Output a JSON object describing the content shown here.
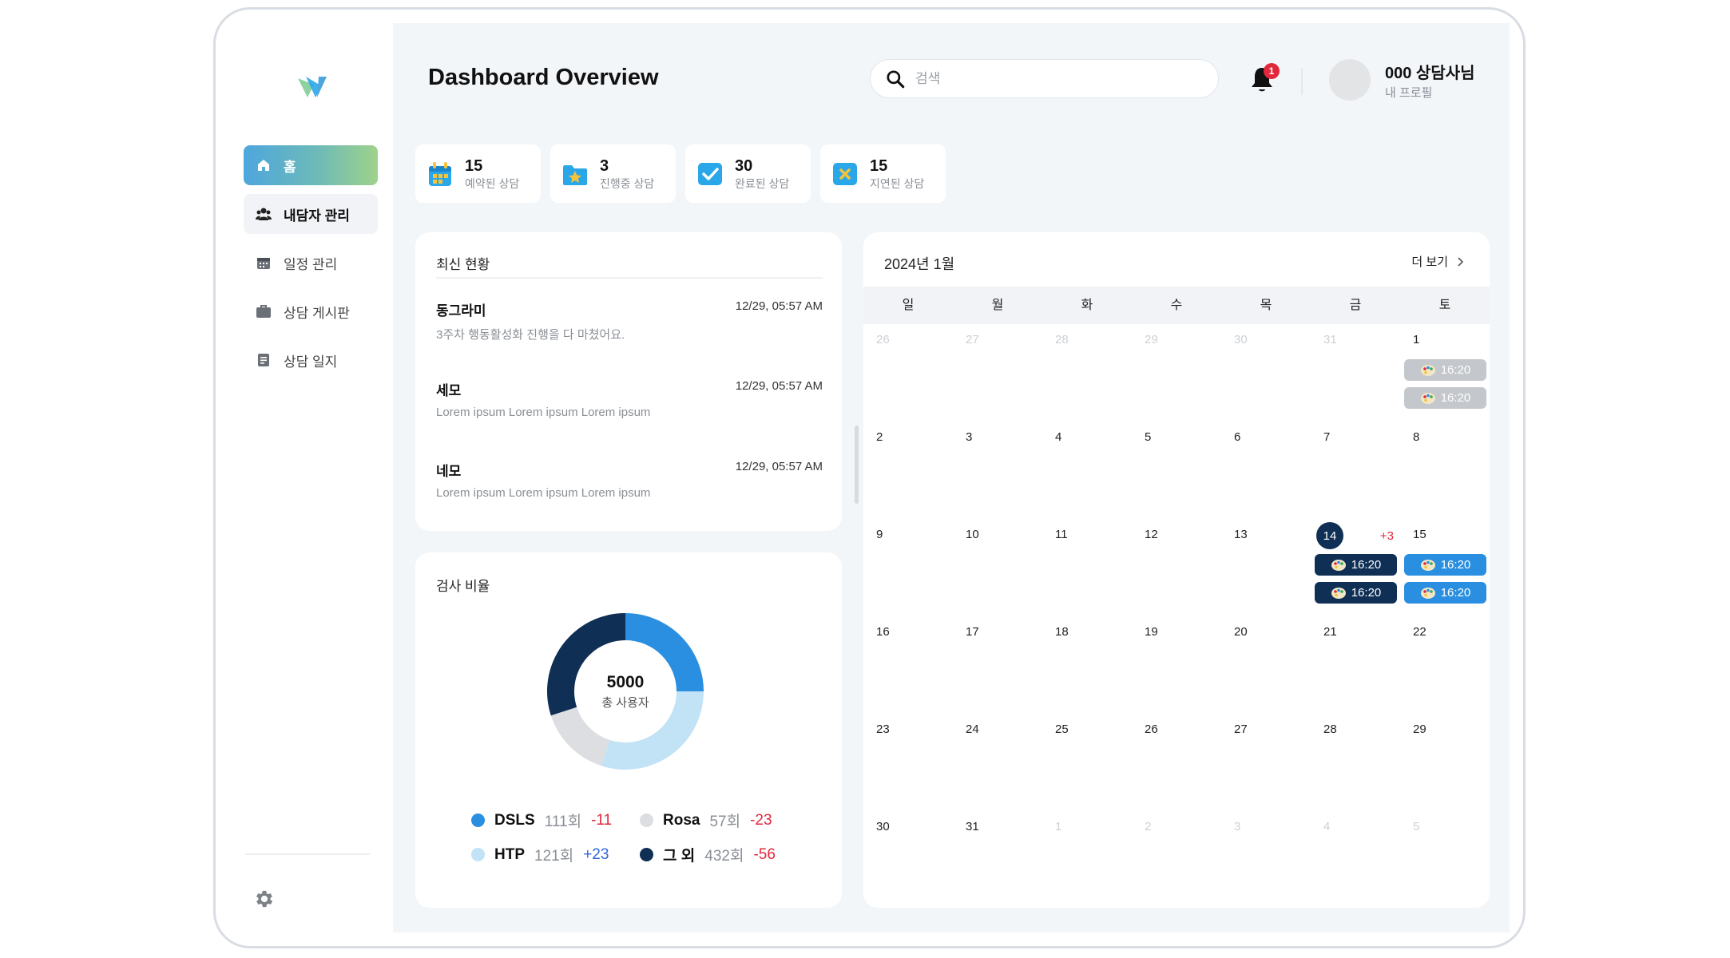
{
  "app": {
    "logo": "v-logo-icon"
  },
  "sidebar": {
    "items": [
      {
        "label": "홈",
        "icon": "home-icon"
      },
      {
        "label": "내담자 관리",
        "icon": "users-icon"
      },
      {
        "label": "일정 관리",
        "icon": "calendar-icon"
      },
      {
        "label": "상담 게시판",
        "icon": "briefcase-icon"
      },
      {
        "label": "상담 일지",
        "icon": "document-icon"
      }
    ],
    "settings_icon": "gear-icon"
  },
  "header": {
    "title": "Dashboard Overview",
    "search_placeholder": "검색",
    "notification_count": "1",
    "user_name": "000 상담사님",
    "user_sub": "내 프로필"
  },
  "stats": [
    {
      "value": "15",
      "label": "예약된 상담",
      "color": "#2aa7e8"
    },
    {
      "value": "3",
      "label": "진행중 상담",
      "color": "#2aa7e8"
    },
    {
      "value": "30",
      "label": "완료된 상담",
      "color": "#2aa7e8"
    },
    {
      "value": "15",
      "label": "지연된 상담",
      "color": "#2aa7e8"
    }
  ],
  "recent": {
    "title": "최신 현황",
    "items": [
      {
        "name": "동그라미",
        "time": "12/29, 05:57 AM",
        "message": "3주차 행동활성화 진행을 다 마쳤어요."
      },
      {
        "name": "세모",
        "time": "12/29, 05:57 AM",
        "message": "Lorem ipsum Lorem ipsum Lorem ipsum"
      },
      {
        "name": "네모",
        "time": "12/29, 05:57 AM",
        "message": "Lorem ipsum Lorem ipsum Lorem ipsum"
      }
    ]
  },
  "ratio": {
    "title": "검사 비율",
    "total": "5000",
    "total_label": "총 사용자",
    "legend": [
      {
        "name": "DSLS",
        "count": "111회",
        "delta": "-11",
        "color": "#2a8fe0"
      },
      {
        "name": "Rosa",
        "count": "57회",
        "delta": "-23",
        "color": "#dcdee1"
      },
      {
        "name": "HTP",
        "count": "121회",
        "delta": "+23",
        "color": "#c2e2f6"
      },
      {
        "name": "그 외",
        "count": "432회",
        "delta": "-56",
        "color": "#0f2f55"
      }
    ]
  },
  "chart_data": {
    "type": "pie",
    "categories": [
      "DSLS",
      "HTP",
      "Rosa",
      "그 외"
    ],
    "values": [
      25,
      30,
      15,
      30
    ],
    "colors": [
      "#2a8fe0",
      "#c2e2f6",
      "#dcdee1",
      "#0f2f55"
    ]
  },
  "calendar": {
    "title": "2024년 1월",
    "more_label": "더 보기",
    "weekdays": [
      "일",
      "월",
      "화",
      "수",
      "목",
      "금",
      "토"
    ],
    "weeks": [
      [
        {
          "d": "26",
          "muted": true
        },
        {
          "d": "27",
          "muted": true
        },
        {
          "d": "28",
          "muted": true
        },
        {
          "d": "29",
          "muted": true
        },
        {
          "d": "30",
          "muted": true
        },
        {
          "d": "31",
          "muted": true
        },
        {
          "d": "1",
          "events": [
            {
              "time": "16:20",
              "style": "gray"
            },
            {
              "time": "16:20",
              "style": "gray"
            }
          ]
        }
      ],
      [
        {
          "d": "2"
        },
        {
          "d": "3"
        },
        {
          "d": "4"
        },
        {
          "d": "5"
        },
        {
          "d": "6"
        },
        {
          "d": "7"
        },
        {
          "d": "8"
        }
      ],
      [
        {
          "d": "9"
        },
        {
          "d": "10"
        },
        {
          "d": "11"
        },
        {
          "d": "12"
        },
        {
          "d": "13"
        },
        {
          "d": "14",
          "today": true,
          "more": "+3",
          "events": [
            {
              "time": "16:20",
              "style": "navy"
            },
            {
              "time": "16:20",
              "style": "navy"
            }
          ]
        },
        {
          "d": "15",
          "events": [
            {
              "time": "16:20",
              "style": "blue"
            },
            {
              "time": "16:20",
              "style": "blue"
            }
          ]
        }
      ],
      [
        {
          "d": "16"
        },
        {
          "d": "17"
        },
        {
          "d": "18"
        },
        {
          "d": "19"
        },
        {
          "d": "20"
        },
        {
          "d": "21"
        },
        {
          "d": "22"
        }
      ],
      [
        {
          "d": "23"
        },
        {
          "d": "24"
        },
        {
          "d": "25"
        },
        {
          "d": "26"
        },
        {
          "d": "27"
        },
        {
          "d": "28"
        },
        {
          "d": "29"
        }
      ],
      [
        {
          "d": "30"
        },
        {
          "d": "31"
        },
        {
          "d": "1",
          "muted": true
        },
        {
          "d": "2",
          "muted": true
        },
        {
          "d": "3",
          "muted": true
        },
        {
          "d": "4",
          "muted": true
        },
        {
          "d": "5",
          "muted": true
        }
      ]
    ]
  }
}
